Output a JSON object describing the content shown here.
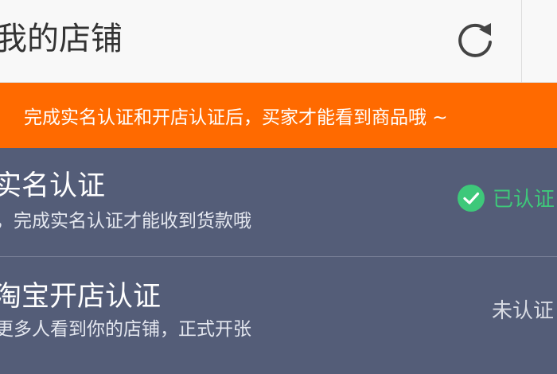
{
  "header": {
    "title": "我的店铺"
  },
  "banner": {
    "text": "完成实名认证和开店认证后，买家才能看到商品哦 ~"
  },
  "items": [
    {
      "title": "实名认证",
      "subtitle": "，完成实名认证才能收到货款哦",
      "status": "已认证",
      "status_color": "#3ec87a"
    },
    {
      "title": "淘宝开店认证",
      "subtitle": "更多人看到你的店铺，正式开张",
      "status": "未认证"
    }
  ],
  "colors": {
    "header_bg": "#f8f8f8",
    "banner_bg": "#ff6a00",
    "list_bg": "#545d78"
  }
}
